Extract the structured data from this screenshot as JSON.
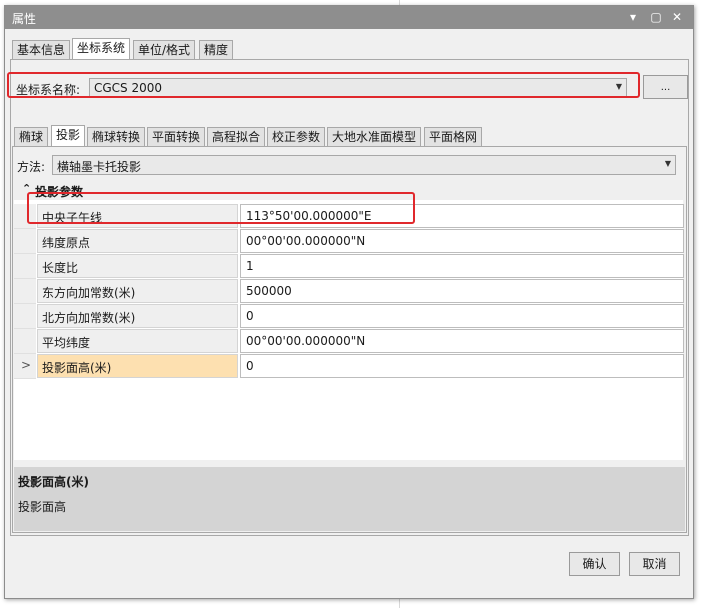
{
  "window": {
    "title": "属性",
    "controls": {
      "pin": "▾",
      "restore": "▢",
      "close": "✕"
    }
  },
  "main_tabs": [
    {
      "label": "基本信息",
      "active": false
    },
    {
      "label": "坐标系统",
      "active": true
    },
    {
      "label": "单位/格式",
      "active": false
    },
    {
      "label": "精度",
      "active": false
    }
  ],
  "cs_name": {
    "label": "坐标系名称:",
    "value": "CGCS 2000",
    "browse_label": "..."
  },
  "sub_tabs": [
    {
      "label": "椭球",
      "active": false
    },
    {
      "label": "投影",
      "active": true
    },
    {
      "label": "椭球转换",
      "active": false
    },
    {
      "label": "平面转换",
      "active": false
    },
    {
      "label": "高程拟合",
      "active": false
    },
    {
      "label": "校正参数",
      "active": false
    },
    {
      "label": "大地水准面模型",
      "active": false
    },
    {
      "label": "平面格网",
      "active": false
    }
  ],
  "method": {
    "label": "方法:",
    "value": "横轴墨卡托投影"
  },
  "section": {
    "title": "投影参数",
    "toggle": "⌃"
  },
  "params": [
    {
      "name": "中央子午线",
      "value": "113°50'00.000000\"E"
    },
    {
      "name": "纬度原点",
      "value": "00°00'00.000000\"N"
    },
    {
      "name": "长度比",
      "value": "1"
    },
    {
      "name": "东方向加常数(米)",
      "value": "500000"
    },
    {
      "name": "北方向加常数(米)",
      "value": "0"
    },
    {
      "name": "平均纬度",
      "value": "00°00'00.000000\"N"
    },
    {
      "name": "投影面高(米)",
      "value": "0"
    }
  ],
  "selected_indicator": ">",
  "description": {
    "title": "投影面高(米)",
    "text": "投影面高"
  },
  "buttons": {
    "ok": "确认",
    "cancel": "取消"
  },
  "colors": {
    "titlebar": "#8e8e8e",
    "highlight": "#e0282c",
    "selected_row": "#fde0b0"
  }
}
